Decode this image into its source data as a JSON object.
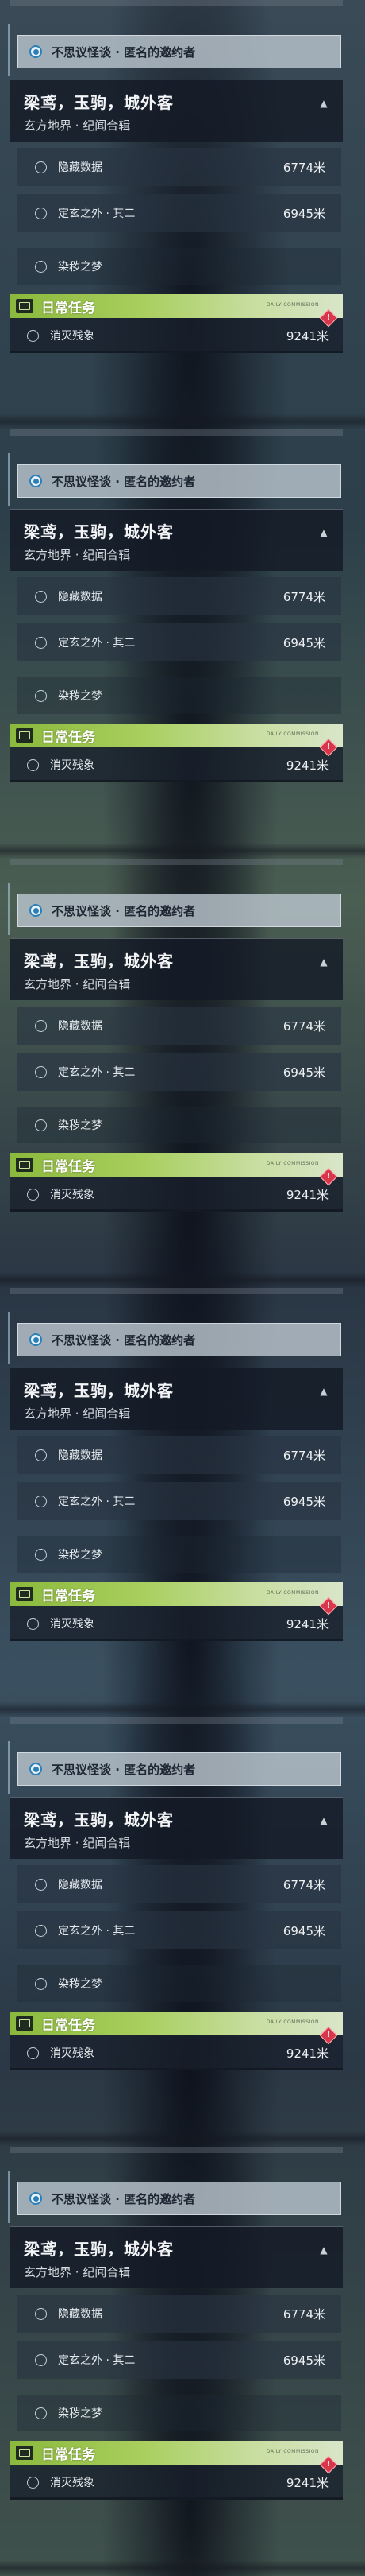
{
  "selected_quest": {
    "label": "不思议怪谈 · 匿名的邀约者"
  },
  "header": {
    "title": "梁鸢，玉驹，城外客",
    "subtitle": "玄方地界 · 纪闻合辑",
    "collapse_icon": "chevron-up-icon"
  },
  "sub_quests": [
    {
      "label": "隐藏数据",
      "distance": "6774米"
    },
    {
      "label": "定玄之外 · 其二",
      "distance": "6945米"
    },
    {
      "label": "染秽之梦",
      "distance": ""
    }
  ],
  "daily": {
    "title": "日常任务",
    "tag": "DAILY COMMISSION",
    "icon": "book-icon",
    "item": {
      "label": "消灭残象",
      "distance": "9241米"
    },
    "warning_icon": "warning-diamond-icon"
  },
  "colors": {
    "daily_bar": "#a9cf5e",
    "selected_radio": "#2a7fb8",
    "warning": "#d8364a"
  }
}
